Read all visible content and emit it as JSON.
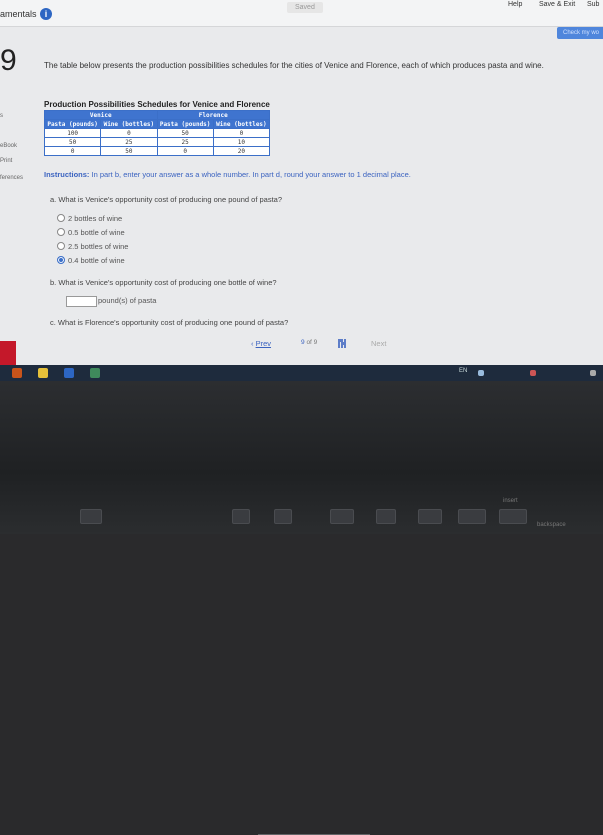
{
  "header": {
    "crumb": "amentals",
    "info_glyph": "i",
    "saved": "Saved",
    "help": "Help",
    "save_exit": "Save & Exit",
    "submit": "Sub",
    "check": "Check my wo"
  },
  "question": {
    "number": "9",
    "intro": "The table below presents the production possibilities schedules for the cities of Venice and Florence, each of which produces pasta and wine."
  },
  "side": {
    "item1": "s",
    "item2": "eBook",
    "item3": "Print",
    "item4": "ferences"
  },
  "table": {
    "title": "Production Possibilities Schedules for Venice and Florence",
    "groups": [
      "Venice",
      "Florence"
    ],
    "columns": [
      "Pasta (pounds)",
      "Wine (bottles)",
      "Pasta (pounds)",
      "Wine (bottles)"
    ],
    "rows": [
      [
        "100",
        "0",
        "50",
        "0"
      ],
      [
        "50",
        "25",
        "25",
        "10"
      ],
      [
        "0",
        "50",
        "0",
        "20"
      ]
    ]
  },
  "instructions": {
    "label": "Instructions:",
    "text": " In part b, enter your answer as a whole number. In part d, round your answer to 1 decimal place."
  },
  "part_a": {
    "prompt": "a. What is Venice's opportunity cost of producing one pound of pasta?",
    "options": [
      "2 bottles of wine",
      "0.5 bottle of wine",
      "2.5 bottles of wine",
      "0.4 bottle of wine"
    ],
    "selected_index": 3
  },
  "part_b": {
    "prompt": "b. What is Venice's opportunity cost of producing one bottle of wine?",
    "unit": "pound(s) of pasta",
    "value": ""
  },
  "part_c": {
    "prompt": "c. What is Florence's opportunity cost of producing one pound of pasta?"
  },
  "pager": {
    "prev": "Prev",
    "current": "9",
    "of_label": "of",
    "total": "9",
    "next": "Next"
  },
  "taskbar": {
    "lang": "EN"
  },
  "keyboard": {
    "backspace": "backspace",
    "insert": "insert"
  }
}
